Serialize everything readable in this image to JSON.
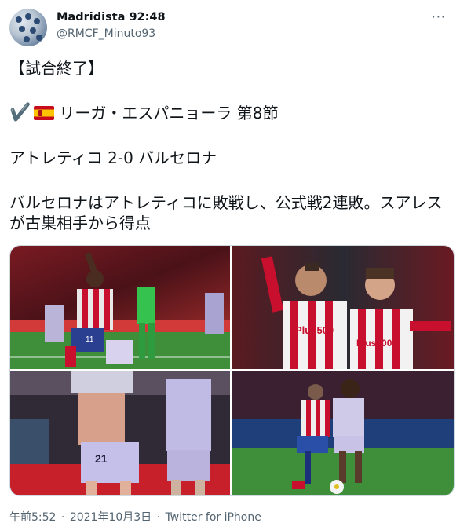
{
  "author": {
    "name": "Madridista 92:48",
    "handle": "@RMCF_Minuto93"
  },
  "more_label": "···",
  "tweet": {
    "line1": "【試合終了】",
    "check": "✔️",
    "line2": "リーガ・エスパニョーラ 第8節",
    "line3": "アトレティコ 2-0 バルセロナ",
    "line4": "バルセロナはアトレティコに敗戦し、公式戦2連敗。スアレスが古巣相手から得点"
  },
  "photos": {
    "p1_number": "11",
    "p2_sponsor_left": "Plus500",
    "p2_sponsor_right": "Plus500",
    "p3_number": "21"
  },
  "footer": {
    "time": "午前5:52",
    "date": "2021年10月3日",
    "source": "Twitter for iPhone",
    "separator": "·"
  }
}
